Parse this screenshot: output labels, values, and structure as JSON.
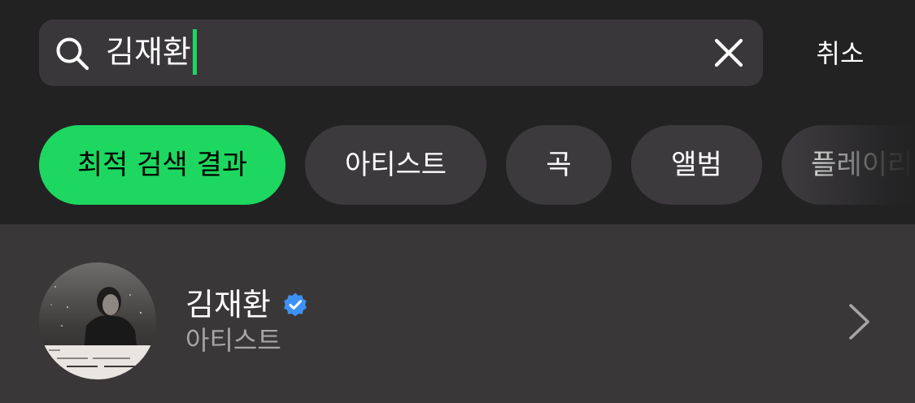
{
  "search": {
    "query": "김재환",
    "cancel_label": "취소"
  },
  "filters": [
    {
      "label": "최적 검색 결과",
      "active": true
    },
    {
      "label": "아티스트",
      "active": false
    },
    {
      "label": "곡",
      "active": false
    },
    {
      "label": "앨범",
      "active": false
    },
    {
      "label": "플레이리스트",
      "active": false
    }
  ],
  "results": [
    {
      "title": "김재환",
      "subtitle": "아티스트",
      "verified": true,
      "image": "artist-photo"
    }
  ],
  "colors": {
    "background": "#232223",
    "search_field": "#393739",
    "chip": "#3c3a3d",
    "accent": "#1ed760",
    "result_row": "#3a3738",
    "muted_text": "#a7a5a6",
    "verified": "#3d91f4"
  },
  "icons": {
    "search": "search-icon",
    "clear": "close-icon",
    "verified": "verified-badge-icon",
    "chevron": "chevron-right-icon"
  }
}
